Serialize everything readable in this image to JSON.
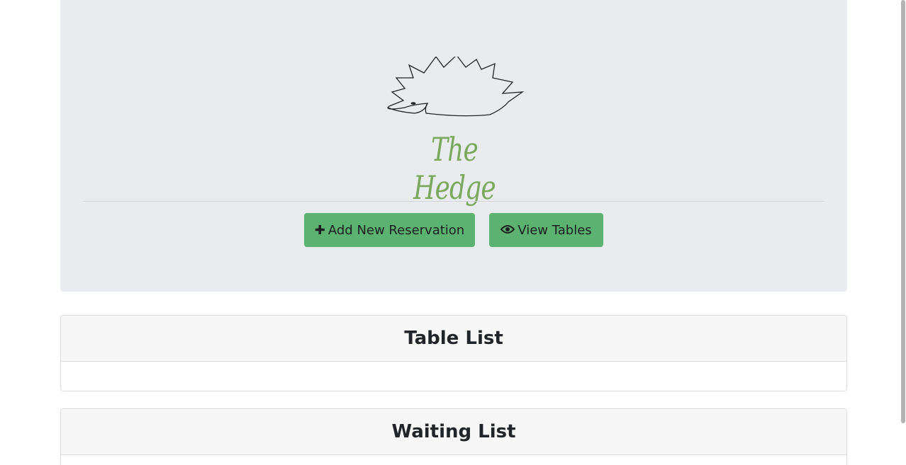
{
  "hero": {
    "logo_text": "The Hedge",
    "buttons": {
      "add_reservation": "Add New Reservation",
      "view_tables": "View Tables"
    }
  },
  "cards": {
    "table_list_title": "Table List",
    "waiting_list_title": "Waiting List"
  },
  "colors": {
    "button_bg": "#5cb270",
    "jumbotron_bg": "#e9ecef",
    "logo_green": "#7aa85d"
  },
  "icons": {
    "add_reservation": "plus-icon",
    "view_tables": "eye-icon"
  }
}
